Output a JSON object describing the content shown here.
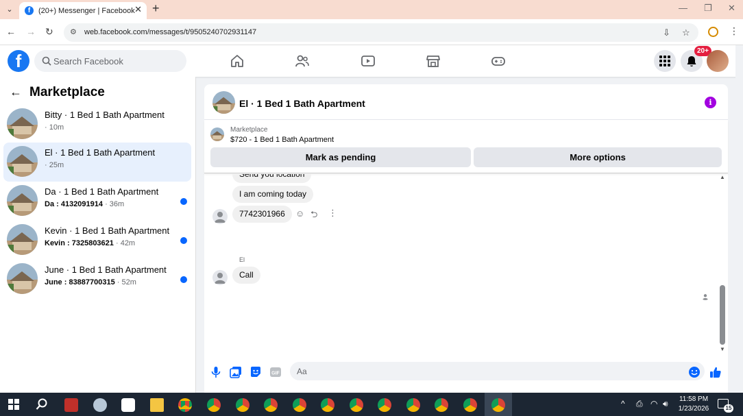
{
  "browser": {
    "tab_title": "(20+) Messenger | Facebook",
    "url": "web.facebook.com/messages/t/9505240702931147"
  },
  "header": {
    "search_placeholder": "Search Facebook",
    "notification_badge": "20+",
    "nav_icons": [
      "home-icon",
      "friends-icon",
      "video-icon",
      "marketplace-icon",
      "gaming-icon"
    ]
  },
  "sidebar": {
    "title": "Marketplace",
    "conversations": [
      {
        "name": "Bitty · 1 Bed 1 Bath Apartment",
        "preview": "",
        "time": "· 10m",
        "unread": false,
        "active": false
      },
      {
        "name": "El · 1 Bed 1 Bath Apartment",
        "preview": "",
        "time": "· 25m",
        "unread": false,
        "active": true
      },
      {
        "name": "Da · 1 Bed 1 Bath Apartment",
        "preview": "Da : 4132091914",
        "time": " · 36m",
        "unread": true,
        "active": false
      },
      {
        "name": "Kevin · 1 Bed 1 Bath Apartment",
        "preview": "Kevin : 7325803621",
        "time": " · 42m",
        "unread": true,
        "active": false
      },
      {
        "name": "June · 1 Bed 1 Bath Apartment",
        "preview": "June : 83887700315",
        "time": " · 52m",
        "unread": true,
        "active": false
      }
    ]
  },
  "chat": {
    "title": "El · 1 Bed 1 Bath Apartment",
    "listing_category": "Marketplace",
    "listing_price_title": "$720 - 1 Bed 1 Bath Apartment",
    "mark_pending_label": "Mark as pending",
    "more_options_label": "More options",
    "messages": [
      {
        "text": "Send you location"
      },
      {
        "text": "I am coming today"
      },
      {
        "text": "7742301966"
      },
      {
        "sender": "El",
        "text": "Call"
      }
    ],
    "composer_placeholder": "Aa"
  },
  "taskbar": {
    "time": "11:58 PM",
    "date": "1/23/2026",
    "notification_count": "15"
  },
  "colors": {
    "fb_blue": "#1877f2",
    "unread_dot": "#0866ff",
    "badge_red": "#e41e3f",
    "info_purple": "#a200e0"
  }
}
